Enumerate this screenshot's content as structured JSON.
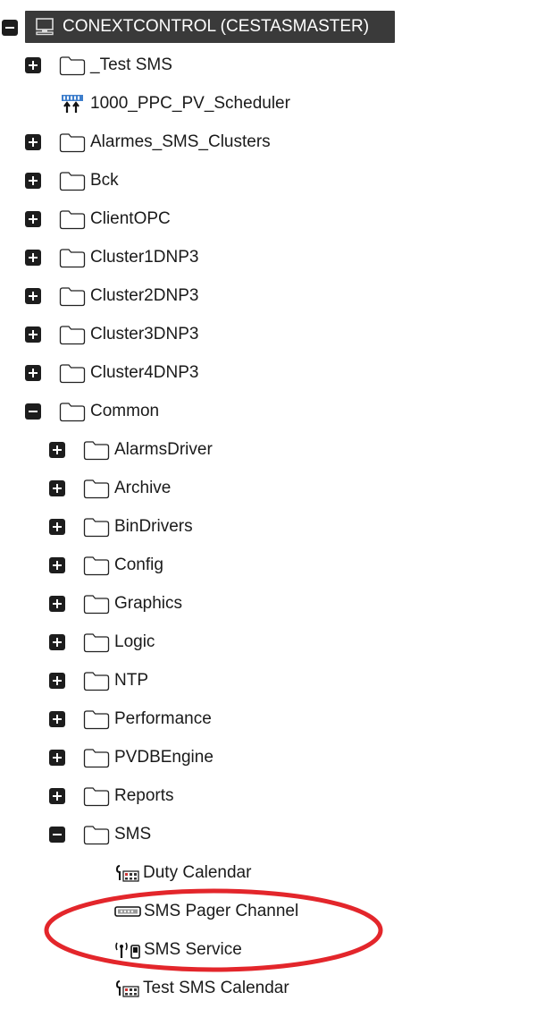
{
  "root": {
    "label": "CONEXTCONTROL (CESTASMASTER)",
    "icon": "computer-icon"
  },
  "level1": [
    {
      "label": "_Test SMS",
      "type": "folder",
      "icon": "folder-icon"
    },
    {
      "label": "1000_PPC_PV_Scheduler",
      "type": "item",
      "icon": "scheduler-icon"
    },
    {
      "label": "Alarmes_SMS_Clusters",
      "type": "folder",
      "icon": "folder-icon"
    },
    {
      "label": "Bck",
      "type": "folder",
      "icon": "folder-icon"
    },
    {
      "label": "ClientOPC",
      "type": "folder",
      "icon": "folder-icon"
    },
    {
      "label": "Cluster1DNP3",
      "type": "folder",
      "icon": "folder-icon"
    },
    {
      "label": "Cluster2DNP3",
      "type": "folder",
      "icon": "folder-icon"
    },
    {
      "label": "Cluster3DNP3",
      "type": "folder",
      "icon": "folder-icon"
    },
    {
      "label": "Cluster4DNP3",
      "type": "folder",
      "icon": "folder-icon"
    },
    {
      "label": "Common",
      "type": "folder",
      "icon": "folder-icon",
      "expanded": true
    }
  ],
  "common_children": [
    {
      "label": "AlarmsDriver",
      "icon": "folder-icon"
    },
    {
      "label": "Archive",
      "icon": "folder-icon"
    },
    {
      "label": "BinDrivers",
      "icon": "folder-icon"
    },
    {
      "label": "Config",
      "icon": "folder-icon"
    },
    {
      "label": "Graphics",
      "icon": "folder-icon"
    },
    {
      "label": "Logic",
      "icon": "folder-icon"
    },
    {
      "label": "NTP",
      "icon": "folder-icon"
    },
    {
      "label": "Performance",
      "icon": "folder-icon"
    },
    {
      "label": "PVDBEngine",
      "icon": "folder-icon"
    },
    {
      "label": "Reports",
      "icon": "folder-icon"
    },
    {
      "label": "SMS",
      "icon": "folder-icon",
      "expanded": true
    }
  ],
  "sms_children": [
    {
      "label": "Duty Calendar",
      "icon": "calendar-icon"
    },
    {
      "label": "SMS Pager Channel",
      "icon": "pager-icon"
    },
    {
      "label": "SMS Service",
      "icon": "antenna-icon"
    },
    {
      "label": "Test SMS Calendar",
      "icon": "calendar-icon"
    }
  ],
  "colors": {
    "root_bg": "#3a3a3a",
    "toggle": "#1d1d1d",
    "annotation": "#e3262b",
    "scheduler": "#3f7fcc"
  }
}
